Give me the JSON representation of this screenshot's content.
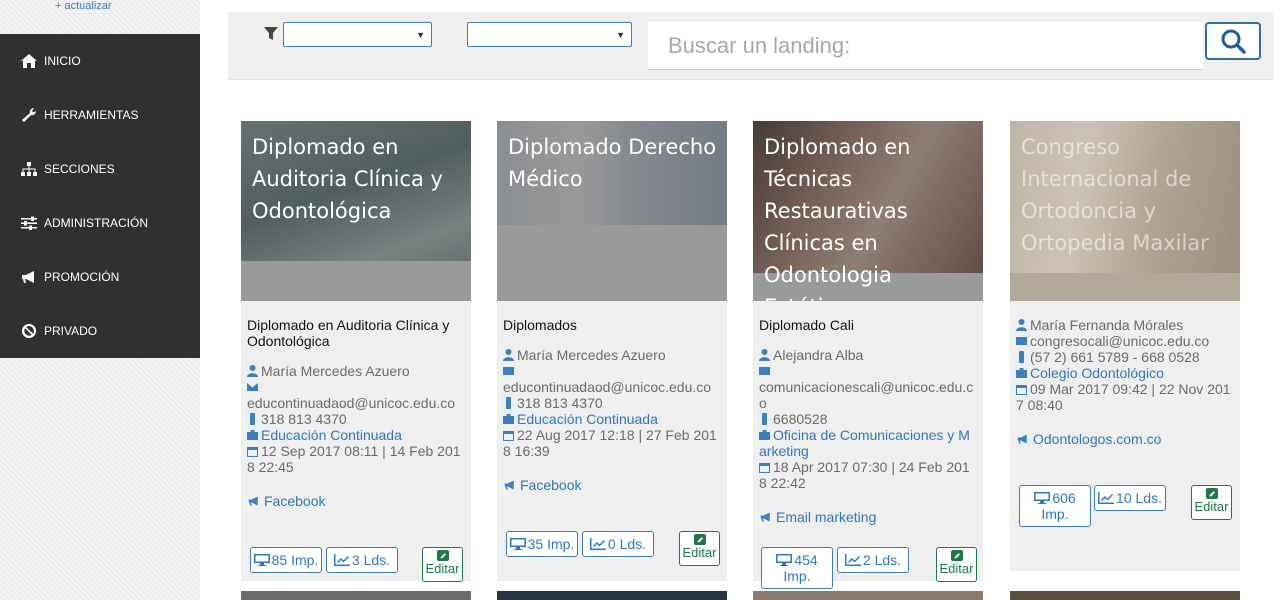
{
  "sidebar": {
    "update_link": "+ actualizar",
    "items": [
      {
        "label": "INICIO",
        "icon": "home-icon"
      },
      {
        "label": "HERRAMIENTAS",
        "icon": "wrench-icon"
      },
      {
        "label": "SECCIONES",
        "icon": "sitemap-icon"
      },
      {
        "label": "ADMINISTRACIÓN",
        "icon": "sliders-icon"
      },
      {
        "label": "PROMOCIÓN",
        "icon": "bullhorn-icon"
      },
      {
        "label": "PRIVADO",
        "icon": "ban-icon"
      }
    ]
  },
  "toolbar": {
    "filter_1_value": "",
    "filter_2_value": "",
    "search_placeholder": "Buscar un landing:",
    "search_value": ""
  },
  "colors": {
    "sidebar_menu_bg": "#303030",
    "link_blue": "#2f78c4",
    "edit_green": "#1f7a46"
  },
  "cards": [
    {
      "thumb_title": "Diplomado en Auditoria Clínica y Odontológica",
      "category": "Diplomado en Auditoria Clínica y Odontológica",
      "owner": "María Mercedes Azuero",
      "email": "educontinuadaod@unicoc.edu.co",
      "phone": "318 813 4370",
      "department": "Educación Continuada",
      "dates": "12 Sep 2017 08:11 | 14 Feb 2018 22:45",
      "promo": "Facebook",
      "impressions": "85 Imp.",
      "leads": "3 Lds.",
      "edit": "Editar"
    },
    {
      "thumb_title": "Diplomado Derecho Médico",
      "category": "Diplomados",
      "owner": "María Mercedes Azuero",
      "email": "educontinuadaod@unicoc.edu.co",
      "phone": "318 813 4370",
      "department": "Educación Continuada",
      "dates": "22 Aug 2017 12:18 | 27 Feb 2018 16:39",
      "promo": "Facebook",
      "impressions": "35 Imp.",
      "leads": "0 Lds.",
      "edit": "Editar"
    },
    {
      "thumb_title": "Diplomado en Técnicas Restaurativas Clínicas en Odontologia Estética",
      "category": "Diplomado Cali",
      "owner": "Alejandra Alba",
      "email": "comunicacionescali@unicoc.edu.co",
      "phone": "6680528",
      "department": "Oficina de Comunicaciones y Marketing",
      "dates": "18 Apr 2017 07:30 | 24 Feb 2018 22:42",
      "promo": "Email marketing",
      "impressions": "454 Imp.",
      "leads": "2 Lds.",
      "edit": "Editar"
    },
    {
      "thumb_title": "Congreso Internacional de Ortodoncia y Ortopedia Maxilar",
      "category": "",
      "owner": "María Fernanda Mórales",
      "email": "congresocali@unicoc.edu.co",
      "phone": "(57 2) 661 5789 - 668 0528",
      "department": "Colegio Odontológico",
      "dates": "09 Mar 2017 09:42 | 22 Nov 2017 08:40",
      "promo": "Odontologos.com.co",
      "impressions": "606 Imp.",
      "leads": "10 Lds.",
      "edit": "Editar"
    }
  ]
}
